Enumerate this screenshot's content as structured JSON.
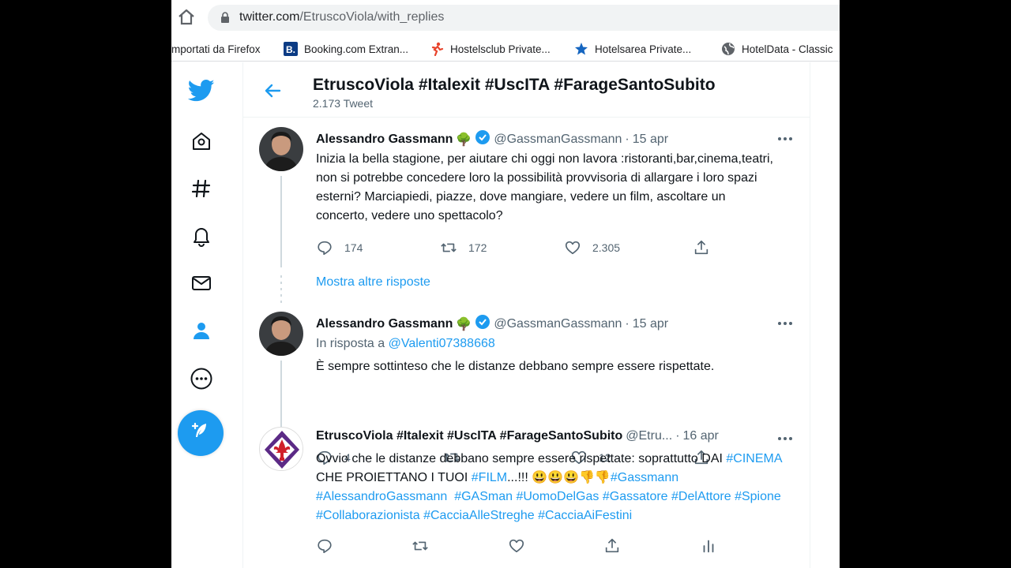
{
  "browser": {
    "url_host": "twitter.com",
    "url_path": "/EtruscoViola/with_replies",
    "bookmarks": [
      {
        "label": "mportati da Firefox"
      },
      {
        "label": "Booking.com Extran...",
        "icon_text": "B."
      },
      {
        "label": "Hostelsclub Private..."
      },
      {
        "label": "Hotelsarea Private..."
      },
      {
        "label": "HotelData - Classic"
      }
    ]
  },
  "header": {
    "title": "EtruscoViola #Italexit #UscITA #FarageSantoSubito",
    "count": "2.173 Tweet"
  },
  "tweets": [
    {
      "name": "Alessandro Gassmann",
      "emoji": "🌳",
      "handle": "@GassmanGassmann",
      "sep": "·",
      "date": "15 apr",
      "text": "Inizia la bella stagione, per aiutare chi oggi non lavora :ristoranti,bar,cinema,teatri, non si potrebbe concedere loro la possibilità provvisoria di allargare i loro spazi esterni? Marciapiedi, piazze, dove mangiare, vedere un film, ascoltare un concerto, vedere uno spettacolo?",
      "replies": "174",
      "retweets": "172",
      "likes": "2.305"
    },
    {
      "name": "Alessandro Gassmann",
      "emoji": "🌳",
      "handle": "@GassmanGassmann",
      "sep": "·",
      "date": "15 apr",
      "reply_prefix": "In risposta a",
      "reply_to": "@Valenti07388668",
      "text": "È sempre sottinteso che le distanze debbano sempre essere rispettate.",
      "replies": "4",
      "retweets": "",
      "likes": "12"
    },
    {
      "name": "EtruscoViola #Italexit #UscITA #FarageSantoSubito",
      "handle": "@Etru...",
      "sep": "·",
      "date": "16 apr",
      "text_parts": [
        "Ovvio che le distanze debbano sempre essere rispettate: soprattutto DAI ",
        "#CINEMA",
        " CHE PROIETTANO I TUOI ",
        "#FILM",
        "...!!! 😃😃😃👎👎",
        "#Gassmann",
        " ",
        "#AlessandroGassmann",
        "  ",
        "#GASman",
        " ",
        "#UomoDelGas",
        " ",
        "#Gassatore",
        " ",
        "#DelAttore",
        " ",
        "#Spione",
        " ",
        "#Collaborazionista",
        " ",
        "#CacciaAlleStreghe",
        " ",
        "#CacciaAiFestini"
      ]
    }
  ],
  "show_more": "Mostra altre risposte",
  "colors": {
    "accent": "#1d9bf0",
    "text": "#0f1419",
    "muted": "#536471",
    "verified": "#1d9bf0",
    "fiorentina_purple": "#5b2a86",
    "fiorentina_red": "#d0202b"
  },
  "icons": [
    "home-icon",
    "lock-icon",
    "twitter-logo-icon",
    "home-nav-icon",
    "hashtag-icon",
    "bell-icon",
    "mail-icon",
    "profile-icon",
    "more-circle-icon",
    "compose-icon",
    "back-arrow-icon",
    "verified-icon",
    "more-dots-icon",
    "reply-icon",
    "retweet-icon",
    "like-icon",
    "share-icon",
    "analytics-icon"
  ]
}
